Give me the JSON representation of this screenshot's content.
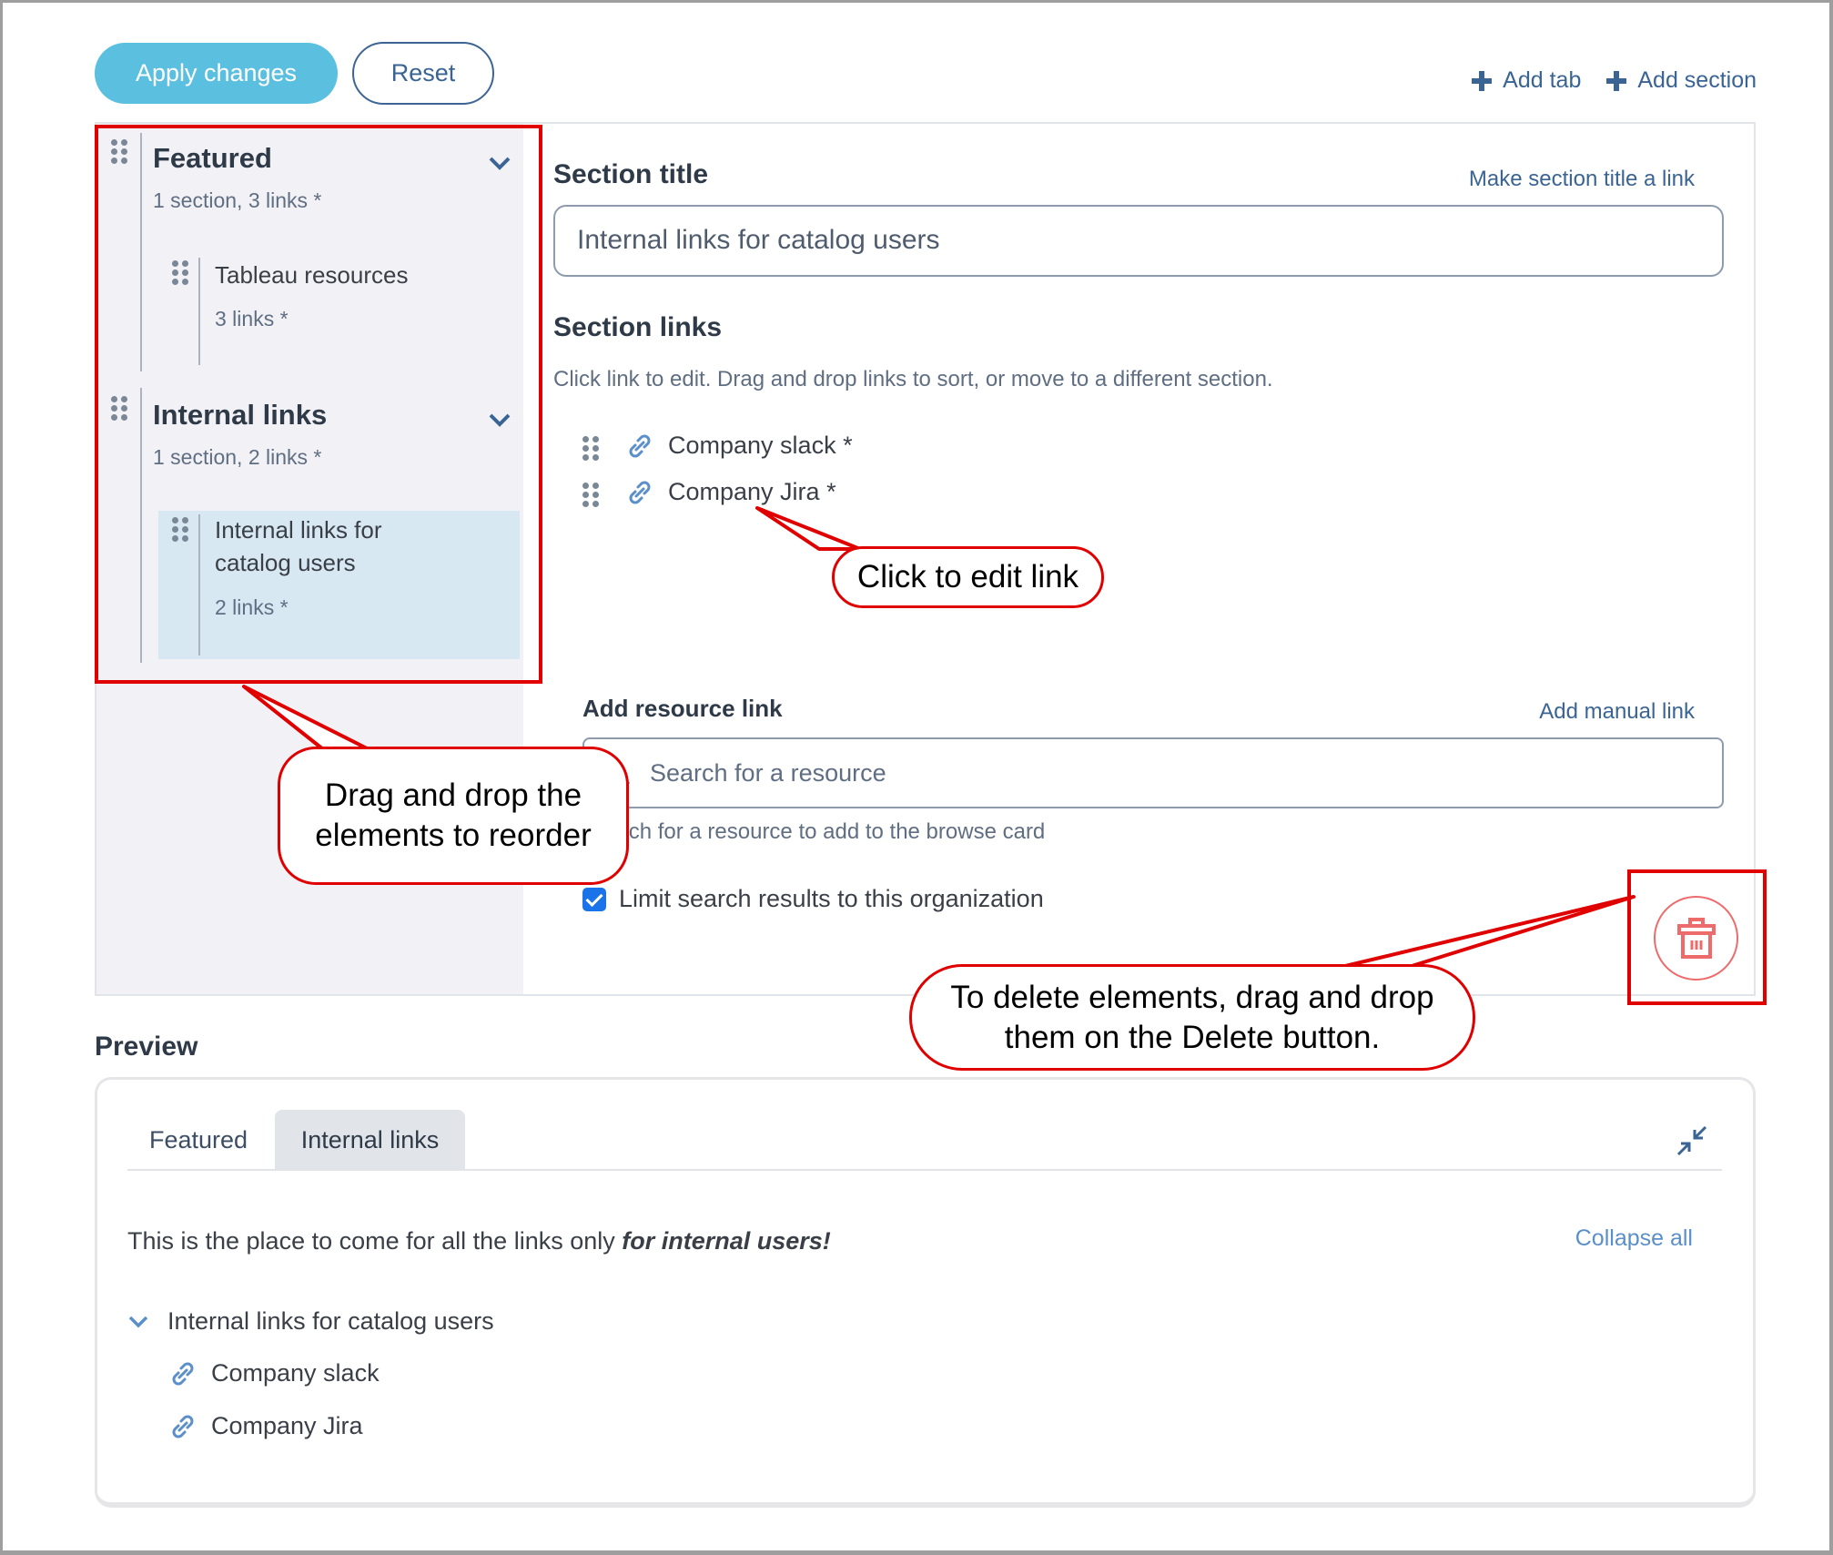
{
  "toolbar": {
    "apply_label": "Apply changes",
    "reset_label": "Reset",
    "add_tab_label": "Add tab",
    "add_section_label": "Add section"
  },
  "sidebar": {
    "tabs": [
      {
        "name": "Featured",
        "meta": "1 section, 3 links *",
        "sections": [
          {
            "name": "Tableau resources",
            "meta": "3 links *",
            "selected": false
          }
        ]
      },
      {
        "name": "Internal links",
        "meta": "1 section, 2 links *",
        "sections": [
          {
            "name_line1": "Internal links for",
            "name_line2": "catalog users",
            "meta": "2 links *",
            "selected": true
          }
        ]
      }
    ]
  },
  "form": {
    "section_title_label": "Section title",
    "make_link_label": "Make section title a link",
    "section_title_value": "Internal links for catalog users",
    "section_links_label": "Section links",
    "section_links_hint": "Click link to edit. Drag and drop links to sort, or move to a different section.",
    "links": [
      {
        "label": "Company slack *"
      },
      {
        "label": "Company Jira *"
      }
    ],
    "add_resource_label": "Add resource link",
    "add_manual_label": "Add manual link",
    "search_placeholder": "Search for a resource",
    "search_hint": "Search for a resource to add to the browse card",
    "limit_checkbox_label": "Limit search results to this organization",
    "limit_checked": true
  },
  "preview": {
    "heading": "Preview",
    "tabs": [
      {
        "label": "Featured",
        "active": false
      },
      {
        "label": "Internal links",
        "active": true
      }
    ],
    "description_plain": "This is the place to come for all the links only ",
    "description_emph": "for internal users!",
    "collapse_all_label": "Collapse all",
    "section_title": "Internal links for catalog users",
    "links": [
      {
        "label": "Company slack"
      },
      {
        "label": "Company Jira"
      }
    ]
  },
  "annotations": {
    "edit_link": "Click to edit link",
    "reorder_line1": "Drag and drop the",
    "reorder_line2": "elements to reorder",
    "delete_line1": "To delete elements, drag and drop",
    "delete_line2": "them on the Delete button."
  },
  "colors": {
    "primary_button": "#5bbfe0",
    "link_blue": "#3a6494",
    "selected_section": "#d7e8f2",
    "sidebar_bg": "#f2f2f6",
    "delete_red": "#ee6b6b",
    "annotation_red": "#e00000",
    "checkbox_blue": "#1a73e8"
  }
}
